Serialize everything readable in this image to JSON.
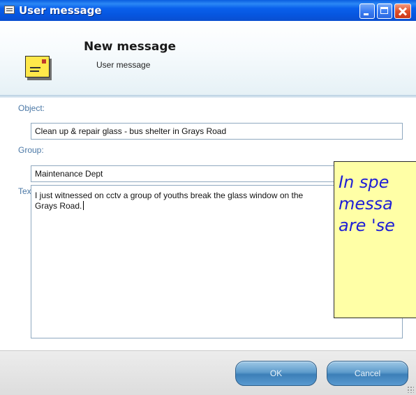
{
  "window": {
    "title": "User message"
  },
  "header": {
    "title": "New message",
    "subtitle": "User message",
    "icon": "envelope-icon"
  },
  "form": {
    "object_label": "Object:",
    "object_value": "Clean up & repair glass - bus shelter in Grays Road",
    "group_label": "Group:",
    "group_value": "Maintenance Dept",
    "text_label": "Text:",
    "text_value": "I just witnessed on cctv a group of youths break the glass window on the\nGrays Road."
  },
  "buttons": {
    "ok_label": "OK",
    "cancel_label": "Cancel"
  },
  "callout": {
    "lines": [
      "In spe",
      "messa",
      "are 'se"
    ]
  },
  "colors": {
    "titlebar": "#0a5ee0",
    "label": "#4b78a6",
    "button": "#5f9ccc",
    "callout_bg": "#ffffa6",
    "callout_text": "#1f1fd6"
  }
}
